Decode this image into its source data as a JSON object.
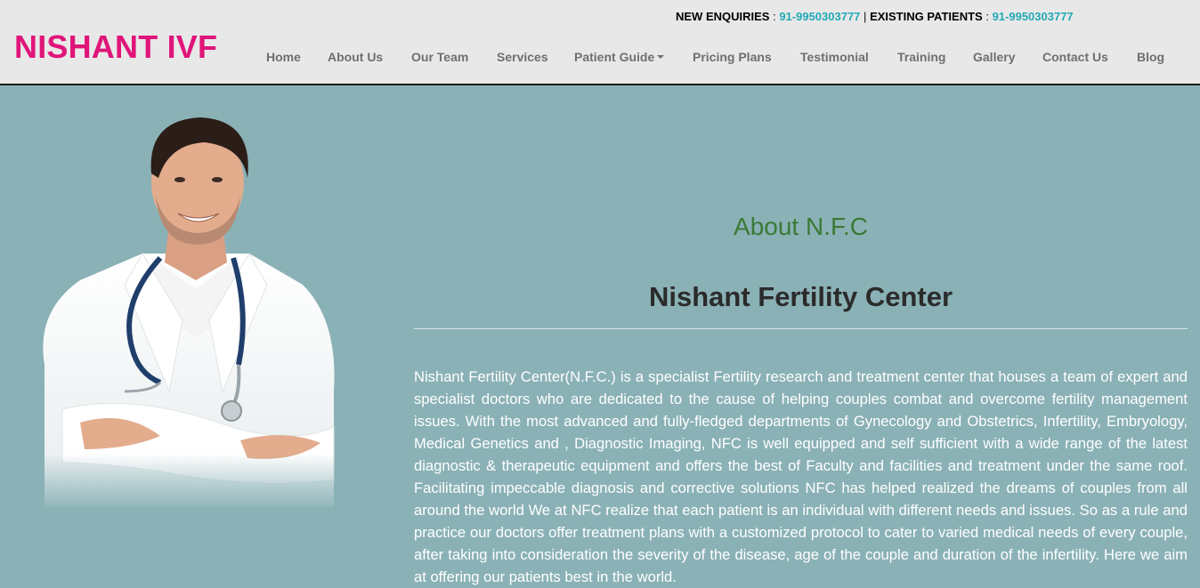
{
  "header": {
    "logo": "NISHANT IVF",
    "contact": {
      "new_label": "NEW ENQUIRIES",
      "new_number": "91-9950303777",
      "separator": "|",
      "existing_label": "EXISTING PATIENTS",
      "existing_number": "91-9950303777"
    },
    "nav": [
      {
        "label": "Home"
      },
      {
        "label": "About Us"
      },
      {
        "label": "Our Team"
      },
      {
        "label": "Services"
      },
      {
        "label": "Patient Guide",
        "dropdown": true
      },
      {
        "label": "Pricing Plans"
      },
      {
        "label": "Testimonial"
      },
      {
        "label": "Training"
      },
      {
        "label": "Gallery"
      },
      {
        "label": "Contact Us"
      },
      {
        "label": "Blog"
      }
    ]
  },
  "main": {
    "section_title": "About N.F.C",
    "heading": "Nishant Fertility Center",
    "paragraph": "Nishant Fertility Center(N.F.C.) is a specialist Fertility research and treatment center that houses a team of expert and specialist doctors who are dedicated to the cause of helping couples combat and overcome fertility management issues. With the most advanced and fully-fledged departments of Gynecology and Obstetrics, Infertility, Embryology, Medical Genetics and , Diagnostic Imaging, NFC is well equipped and self sufficient with a wide range of the latest diagnostic & therapeutic equipment and offers the best of Faculty and facilities and treatment under the same roof. Facilitating impeccable diagnosis and corrective solutions NFC has helped realized the dreams of couples from all around the world We at NFC realize that each patient is an individual with different needs and issues. So as a rule and practice our doctors offer treatment plans with a customized protocol to cater to varied medical needs of every couple, after taking into consideration the severity of the disease, age of the couple and duration of the infertility. Here we aim at offering our patients best in the world.",
    "image": "doctor-with-stethoscope"
  },
  "colors": {
    "logo": "#e0157a",
    "phone": "#23a9b5",
    "background": "#8ab1b6",
    "section_title": "#3a7a36"
  }
}
